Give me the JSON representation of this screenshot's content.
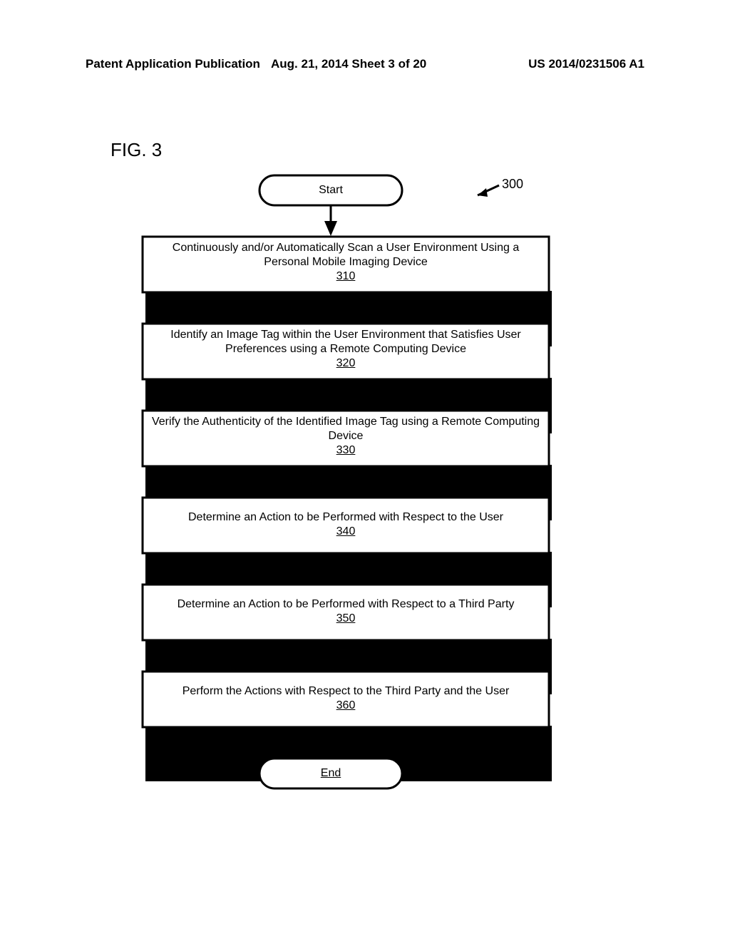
{
  "header": {
    "left": "Patent Application Publication",
    "mid": "Aug. 21, 2014  Sheet 3 of 20",
    "right": "US 2014/0231506 A1"
  },
  "figure_label": "FIG. 3",
  "callout_ref": "300",
  "terminals": {
    "start": "Start",
    "end": "End"
  },
  "steps": [
    {
      "text": "Continuously and/or Automatically Scan a User Environment Using a Personal Mobile Imaging Device",
      "ref": "310"
    },
    {
      "text": "Identify an Image Tag within the User Environment that Satisfies User Preferences using a Remote Computing Device",
      "ref": "320"
    },
    {
      "text": "Verify the Authenticity of the Identified Image Tag using a Remote Computing Device",
      "ref": "330"
    },
    {
      "text": "Determine an Action to be Performed with Respect to the User",
      "ref": "340"
    },
    {
      "text": "Determine an Action to be Performed with Respect to a Third Party",
      "ref": "350"
    },
    {
      "text": "Perform the Actions with Respect to the Third Party and the User",
      "ref": "360"
    }
  ]
}
